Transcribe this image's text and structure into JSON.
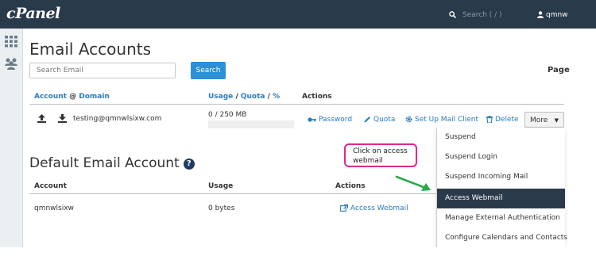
{
  "header": {
    "logo": "cPanel",
    "search_placeholder": "Search ( / )",
    "username": "qmnw"
  },
  "email_accounts": {
    "title": "Email Accounts",
    "search_placeholder": "Search Email",
    "search_button": "Search",
    "page_label": "Page",
    "columns": {
      "account": "Account",
      "at": "@",
      "domain": "Domain",
      "usage": "Usage",
      "quota": "Quota",
      "percent": "%",
      "slash": "/",
      "actions": "Actions"
    },
    "row": {
      "email": "testing@qmnwlsixw.com",
      "usage": "0 / 250 MB",
      "usage_fraction": 0
    },
    "actions": {
      "password": "Password",
      "quota": "Quota",
      "setup": "Set Up Mail Client",
      "delete": "Delete",
      "more": "More"
    }
  },
  "default_account": {
    "title": "Default Email Account",
    "columns": {
      "account": "Account",
      "usage": "Usage",
      "actions": "Actions"
    },
    "row": {
      "account": "qmnwlsixw",
      "usage": "0 bytes",
      "action": "Access Webmail"
    }
  },
  "annotation": {
    "line1": "Click on access",
    "line2": "webmail",
    "border_color": "#e0288f",
    "arrow_color": "#2aa84a"
  },
  "dropdown": {
    "items": [
      "Suspend",
      "Suspend Login",
      "Suspend Incoming Mail",
      "Access Webmail",
      "Manage External Authentication",
      "Configure Calendars and Contacts"
    ],
    "active_item": "Access Webmail"
  },
  "colors": {
    "topbar": "#293a4a",
    "link": "#2a7bbf",
    "primary_button": "#2d8fd5",
    "active_menu": "#2b3a4a"
  }
}
